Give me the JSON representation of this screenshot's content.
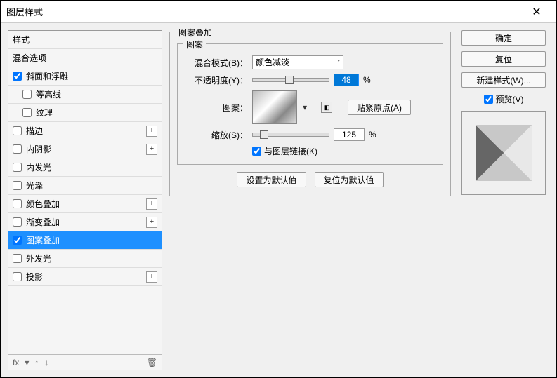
{
  "window": {
    "title": "图层样式"
  },
  "styles": {
    "header": "样式",
    "blend_options": "混合选项",
    "bevel_emboss": "斜面和浮雕",
    "contour": "等高线",
    "texture": "纹理",
    "stroke": "描边",
    "inner_shadow": "内阴影",
    "inner_glow": "内发光",
    "satin": "光泽",
    "color_overlay": "颜色叠加",
    "gradient_overlay": "渐变叠加",
    "pattern_overlay": "图案叠加",
    "outer_glow": "外发光",
    "drop_shadow": "投影"
  },
  "checked": {
    "bevel_emboss": true,
    "contour": false,
    "texture": false,
    "stroke": false,
    "inner_shadow": false,
    "inner_glow": false,
    "satin": false,
    "color_overlay": false,
    "gradient_overlay": false,
    "pattern_overlay": true,
    "outer_glow": false,
    "drop_shadow": false
  },
  "section": {
    "title": "图案叠加",
    "subtitle": "图案",
    "blend_mode_label": "混合模式(B)：",
    "blend_mode_value": "颜色减淡",
    "opacity_label": "不透明度(Y)：",
    "opacity_value": "48",
    "opacity_unit": "%",
    "pattern_label": "图案：",
    "snap_origin": "贴紧原点(A)",
    "scale_label": "缩放(S)：",
    "scale_value": "125",
    "scale_unit": "%",
    "link_with_layer": "与图层链接(K)",
    "set_default": "设置为默认值",
    "reset_default": "复位为默认值"
  },
  "actions": {
    "ok": "确定",
    "cancel": "复位",
    "new_style": "新建样式(W)...",
    "preview": "预览(V)"
  },
  "footer": {
    "fx": "fx"
  }
}
